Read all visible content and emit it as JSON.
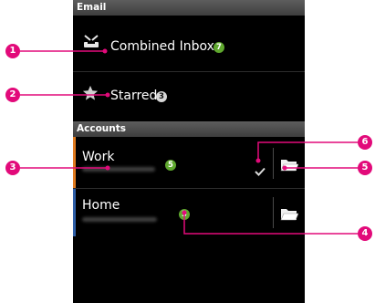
{
  "header": {
    "title": "Email"
  },
  "mailboxes": [
    {
      "label": "Combined Inbox",
      "unread": "7",
      "icon": "combined-inbox-icon",
      "badge_color": "#5fa82e"
    },
    {
      "label": "Starred",
      "unread": "3",
      "icon": "star-icon",
      "badge_color": "#d8d8d8"
    }
  ],
  "accounts_header": "Accounts",
  "accounts": [
    {
      "name": "Work",
      "unread": "5",
      "stripe_color": "#e07a1f",
      "badge_color": "#5fa82e",
      "checked": true,
      "folder_icon": "folder-icon"
    },
    {
      "name": "Home",
      "unread": "3",
      "stripe_color": "#2e5fa8",
      "badge_color": "#5fa82e",
      "checked": false,
      "folder_icon": "folder-icon"
    }
  ],
  "callouts": [
    "1",
    "2",
    "3",
    "4",
    "5",
    "6"
  ],
  "colors": {
    "callout": "#e20a7a",
    "background": "#000000",
    "accent_green": "#5fa82e"
  }
}
